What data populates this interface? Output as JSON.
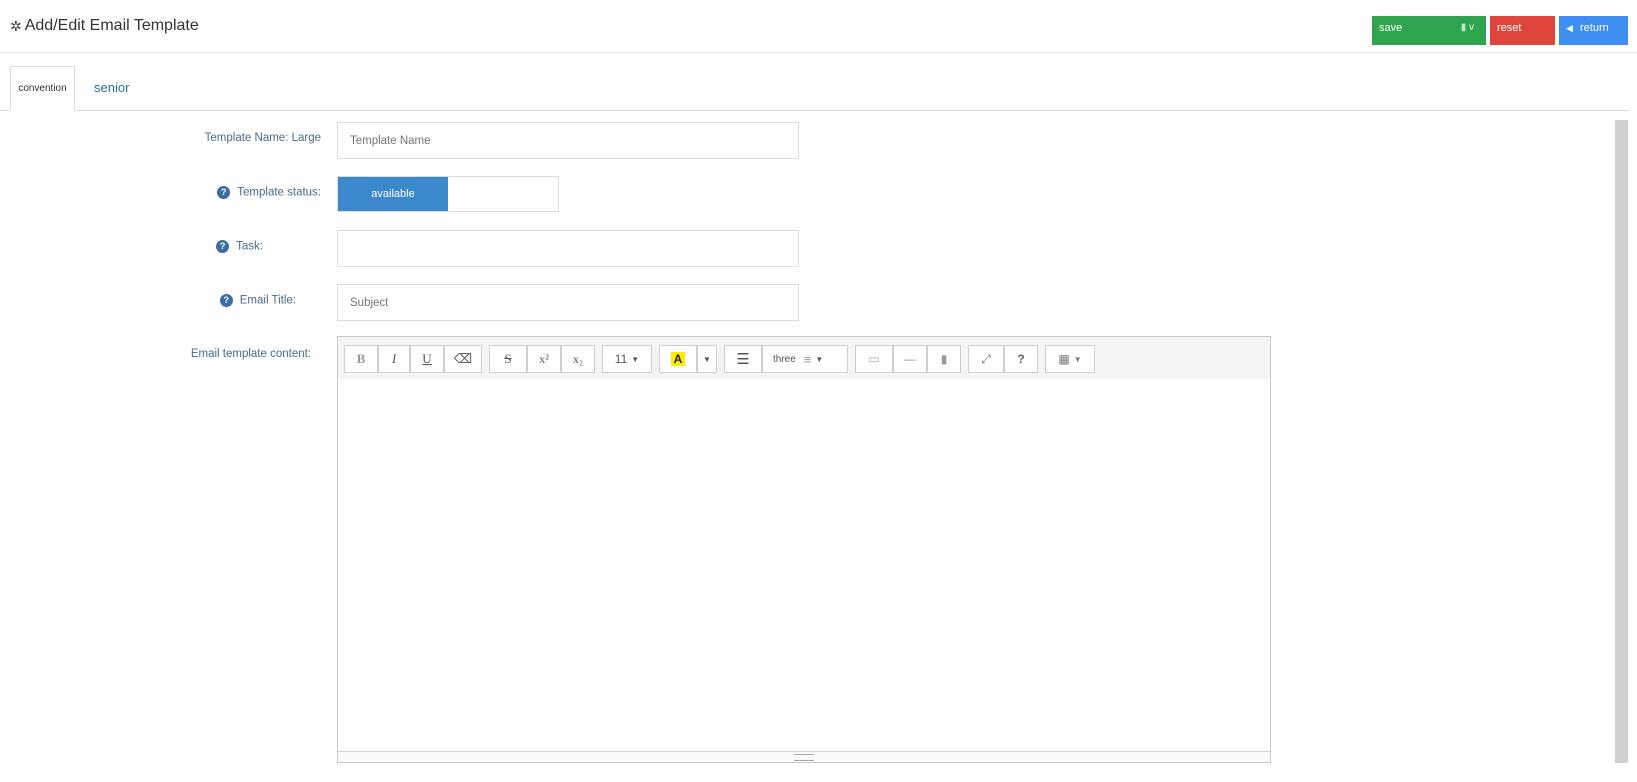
{
  "header": {
    "title": "Add/Edit Email Template",
    "gear_icon": "gear-icon",
    "buttons": {
      "save_label": "save",
      "save_extra": "v",
      "reset_label": "reset",
      "return_label": "return",
      "return_icon": "left-arrow-icon"
    },
    "colors": {
      "save": "#2fa44f",
      "reset": "#e0453c",
      "return": "#3f8ef2"
    }
  },
  "tabs": [
    {
      "label": "convention",
      "active": true
    },
    {
      "label": "senior",
      "active": false
    }
  ],
  "form": {
    "template_name": {
      "label": "Template Name: Large",
      "placeholder": "Template Name",
      "value": ""
    },
    "template_status": {
      "label": "Template status:",
      "value": "available",
      "accent": "#3b88cc"
    },
    "task": {
      "label": "Task:",
      "value": ""
    },
    "email_title": {
      "label": "Email Title:",
      "placeholder": "Subject",
      "value": ""
    },
    "email_content": {
      "label": "Email template content:"
    }
  },
  "editor": {
    "toolbar": {
      "font_size": "11",
      "text_color_letter": "A",
      "paragraph_label": "three",
      "help_label": "?"
    },
    "toolbar_icons": [
      "bold-icon",
      "italic-icon",
      "underline-icon",
      "eraser-icon",
      "strikethrough-icon",
      "superscript-icon",
      "subscript-icon",
      "font-size-dropdown",
      "text-color-icon",
      "color-caret-icon",
      "unordered-list-icon",
      "paragraph-icon",
      "align-dropdown-icon",
      "image-icon",
      "horizontal-rule-icon",
      "file-icon",
      "fullscreen-icon",
      "help-icon",
      "table-icon"
    ]
  }
}
